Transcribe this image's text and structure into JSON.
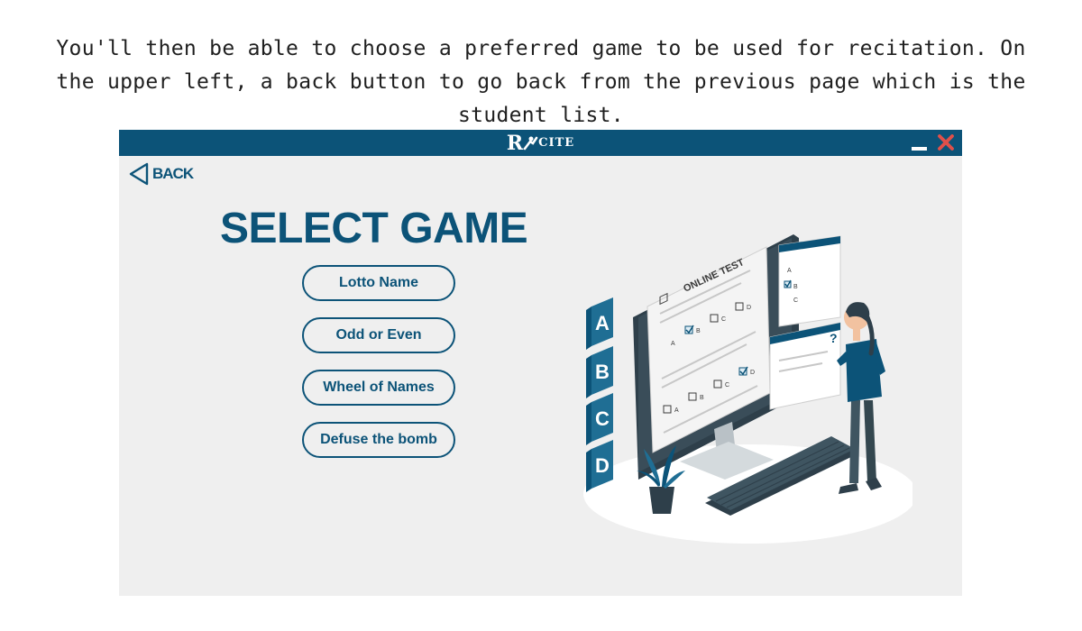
{
  "caption": "You'll then be able to choose a preferred game to be used for recitation. On the upper left, a back button to go back from the previous page which is the student list.",
  "app": {
    "brand": {
      "letter": "R",
      "rest": "CITE"
    },
    "back_label": "BACK",
    "title": "SELECT GAME",
    "games": [
      "Lotto Name",
      "Odd or Even",
      "Wheel of Names",
      "Defuse the bomb"
    ]
  },
  "illustration": {
    "heading": "ONLINE TEST",
    "options": [
      "A",
      "B",
      "C",
      "D"
    ],
    "question_mark": "?"
  },
  "colors": {
    "primary": "#0c5378",
    "titlebar": "#0c5378",
    "close": "#e0504a",
    "app_background": "#efefef"
  },
  "icons": {
    "back": "back-triangle-icon",
    "minimize": "minimize-icon",
    "close": "close-icon"
  }
}
